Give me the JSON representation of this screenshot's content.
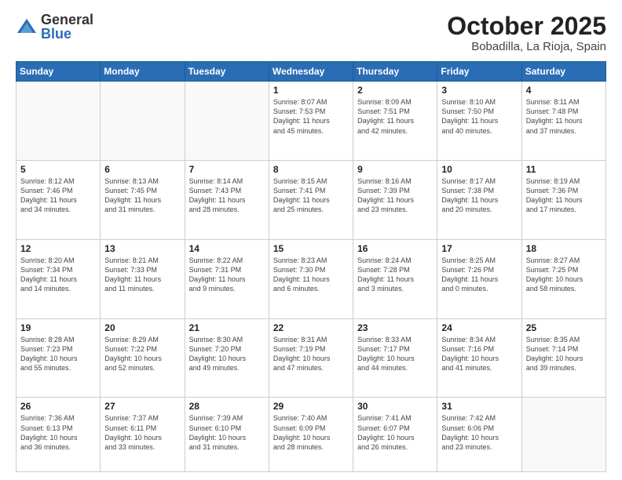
{
  "header": {
    "logo_general": "General",
    "logo_blue": "Blue",
    "month_title": "October 2025",
    "location": "Bobadilla, La Rioja, Spain"
  },
  "days_of_week": [
    "Sunday",
    "Monday",
    "Tuesday",
    "Wednesday",
    "Thursday",
    "Friday",
    "Saturday"
  ],
  "weeks": [
    [
      {
        "num": "",
        "info": ""
      },
      {
        "num": "",
        "info": ""
      },
      {
        "num": "",
        "info": ""
      },
      {
        "num": "1",
        "info": "Sunrise: 8:07 AM\nSunset: 7:53 PM\nDaylight: 11 hours\nand 45 minutes."
      },
      {
        "num": "2",
        "info": "Sunrise: 8:09 AM\nSunset: 7:51 PM\nDaylight: 11 hours\nand 42 minutes."
      },
      {
        "num": "3",
        "info": "Sunrise: 8:10 AM\nSunset: 7:50 PM\nDaylight: 11 hours\nand 40 minutes."
      },
      {
        "num": "4",
        "info": "Sunrise: 8:11 AM\nSunset: 7:48 PM\nDaylight: 11 hours\nand 37 minutes."
      }
    ],
    [
      {
        "num": "5",
        "info": "Sunrise: 8:12 AM\nSunset: 7:46 PM\nDaylight: 11 hours\nand 34 minutes."
      },
      {
        "num": "6",
        "info": "Sunrise: 8:13 AM\nSunset: 7:45 PM\nDaylight: 11 hours\nand 31 minutes."
      },
      {
        "num": "7",
        "info": "Sunrise: 8:14 AM\nSunset: 7:43 PM\nDaylight: 11 hours\nand 28 minutes."
      },
      {
        "num": "8",
        "info": "Sunrise: 8:15 AM\nSunset: 7:41 PM\nDaylight: 11 hours\nand 25 minutes."
      },
      {
        "num": "9",
        "info": "Sunrise: 8:16 AM\nSunset: 7:39 PM\nDaylight: 11 hours\nand 23 minutes."
      },
      {
        "num": "10",
        "info": "Sunrise: 8:17 AM\nSunset: 7:38 PM\nDaylight: 11 hours\nand 20 minutes."
      },
      {
        "num": "11",
        "info": "Sunrise: 8:19 AM\nSunset: 7:36 PM\nDaylight: 11 hours\nand 17 minutes."
      }
    ],
    [
      {
        "num": "12",
        "info": "Sunrise: 8:20 AM\nSunset: 7:34 PM\nDaylight: 11 hours\nand 14 minutes."
      },
      {
        "num": "13",
        "info": "Sunrise: 8:21 AM\nSunset: 7:33 PM\nDaylight: 11 hours\nand 11 minutes."
      },
      {
        "num": "14",
        "info": "Sunrise: 8:22 AM\nSunset: 7:31 PM\nDaylight: 11 hours\nand 9 minutes."
      },
      {
        "num": "15",
        "info": "Sunrise: 8:23 AM\nSunset: 7:30 PM\nDaylight: 11 hours\nand 6 minutes."
      },
      {
        "num": "16",
        "info": "Sunrise: 8:24 AM\nSunset: 7:28 PM\nDaylight: 11 hours\nand 3 minutes."
      },
      {
        "num": "17",
        "info": "Sunrise: 8:25 AM\nSunset: 7:26 PM\nDaylight: 11 hours\nand 0 minutes."
      },
      {
        "num": "18",
        "info": "Sunrise: 8:27 AM\nSunset: 7:25 PM\nDaylight: 10 hours\nand 58 minutes."
      }
    ],
    [
      {
        "num": "19",
        "info": "Sunrise: 8:28 AM\nSunset: 7:23 PM\nDaylight: 10 hours\nand 55 minutes."
      },
      {
        "num": "20",
        "info": "Sunrise: 8:29 AM\nSunset: 7:22 PM\nDaylight: 10 hours\nand 52 minutes."
      },
      {
        "num": "21",
        "info": "Sunrise: 8:30 AM\nSunset: 7:20 PM\nDaylight: 10 hours\nand 49 minutes."
      },
      {
        "num": "22",
        "info": "Sunrise: 8:31 AM\nSunset: 7:19 PM\nDaylight: 10 hours\nand 47 minutes."
      },
      {
        "num": "23",
        "info": "Sunrise: 8:33 AM\nSunset: 7:17 PM\nDaylight: 10 hours\nand 44 minutes."
      },
      {
        "num": "24",
        "info": "Sunrise: 8:34 AM\nSunset: 7:16 PM\nDaylight: 10 hours\nand 41 minutes."
      },
      {
        "num": "25",
        "info": "Sunrise: 8:35 AM\nSunset: 7:14 PM\nDaylight: 10 hours\nand 39 minutes."
      }
    ],
    [
      {
        "num": "26",
        "info": "Sunrise: 7:36 AM\nSunset: 6:13 PM\nDaylight: 10 hours\nand 36 minutes."
      },
      {
        "num": "27",
        "info": "Sunrise: 7:37 AM\nSunset: 6:11 PM\nDaylight: 10 hours\nand 33 minutes."
      },
      {
        "num": "28",
        "info": "Sunrise: 7:39 AM\nSunset: 6:10 PM\nDaylight: 10 hours\nand 31 minutes."
      },
      {
        "num": "29",
        "info": "Sunrise: 7:40 AM\nSunset: 6:09 PM\nDaylight: 10 hours\nand 28 minutes."
      },
      {
        "num": "30",
        "info": "Sunrise: 7:41 AM\nSunset: 6:07 PM\nDaylight: 10 hours\nand 26 minutes."
      },
      {
        "num": "31",
        "info": "Sunrise: 7:42 AM\nSunset: 6:06 PM\nDaylight: 10 hours\nand 23 minutes."
      },
      {
        "num": "",
        "info": ""
      }
    ]
  ]
}
